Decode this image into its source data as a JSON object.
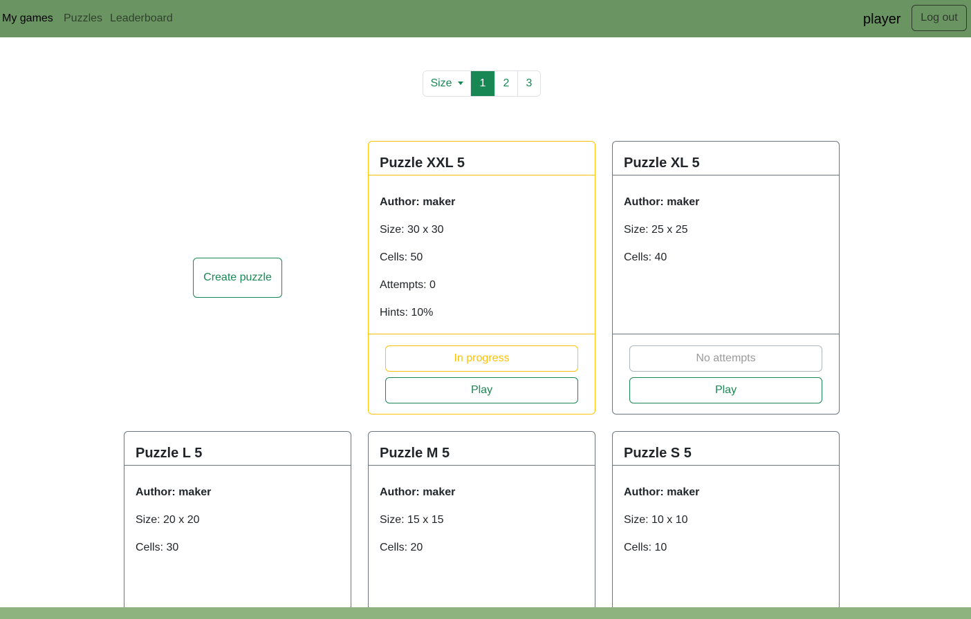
{
  "nav": {
    "items": [
      "My games",
      "Puzzles",
      "Leaderboard"
    ],
    "user": "player",
    "logout_label": "Log out"
  },
  "pagination": {
    "size_label": "Size",
    "pages": [
      "1",
      "2",
      "3"
    ],
    "active_page": "1"
  },
  "create_label": "Create puzzle",
  "cards": [
    {
      "title": "Puzzle XXL 5",
      "author": "Author: maker",
      "size": "Size: 30 x 30",
      "cells": "Cells: 50",
      "attempts": "Attempts: 0",
      "hints": "Hints: 10%",
      "status": "In progress",
      "play": "Play"
    },
    {
      "title": "Puzzle XL 5",
      "author": "Author: maker",
      "size": "Size: 25 x 25",
      "cells": "Cells: 40",
      "status": "No attempts",
      "play": "Play"
    },
    {
      "title": "Puzzle L 5",
      "author": "Author: maker",
      "size": "Size: 20 x 20",
      "cells": "Cells: 30"
    },
    {
      "title": "Puzzle M 5",
      "author": "Author: maker",
      "size": "Size: 15 x 15",
      "cells": "Cells: 20"
    },
    {
      "title": "Puzzle S 5",
      "author": "Author: maker",
      "size": "Size: 10 x 10",
      "cells": "Cells: 10"
    }
  ],
  "colors": {
    "navbar": "#6b9463",
    "accent": "#198754",
    "warning": "#ffc107",
    "footer": "#8fb37f"
  }
}
